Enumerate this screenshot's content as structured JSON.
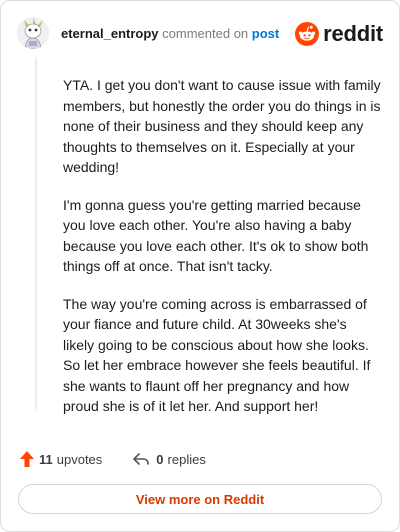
{
  "header": {
    "username": "eternal_entropy",
    "commented_text": "commented on",
    "post_link_text": "post",
    "brand_name": "reddit"
  },
  "comment": {
    "paragraphs": [
      "YTA. I get you don't want to cause issue with family members, but honestly the order you do things in is none of their business and they should keep any thoughts to themselves on it. Especially at your wedding!",
      "I'm gonna guess you're getting married because you love each other. You're also having a baby because you love each other. It's ok to show both things off at once. That isn't tacky.",
      "The way you're coming across is embarrassed of your fiance and future child. At 30weeks she's likely going to be conscious about how she looks. So let her embrace however she feels beautiful. If she wants to flaunt off her pregnancy and how proud she is of it let her. And support her!"
    ]
  },
  "actions": {
    "upvotes_count": "11",
    "upvotes_label": "upvotes",
    "replies_count": "0",
    "replies_label": "replies"
  },
  "footer": {
    "view_more_label": "View more on Reddit"
  },
  "icons": {
    "upvote": "upvote-arrow-icon",
    "reply": "reply-arrow-icon",
    "brand": "reddit-logo-icon",
    "avatar": "user-avatar"
  },
  "colors": {
    "accent_orange": "#ff4500",
    "link_blue": "#0079d3",
    "view_more_text": "#d93a00"
  }
}
